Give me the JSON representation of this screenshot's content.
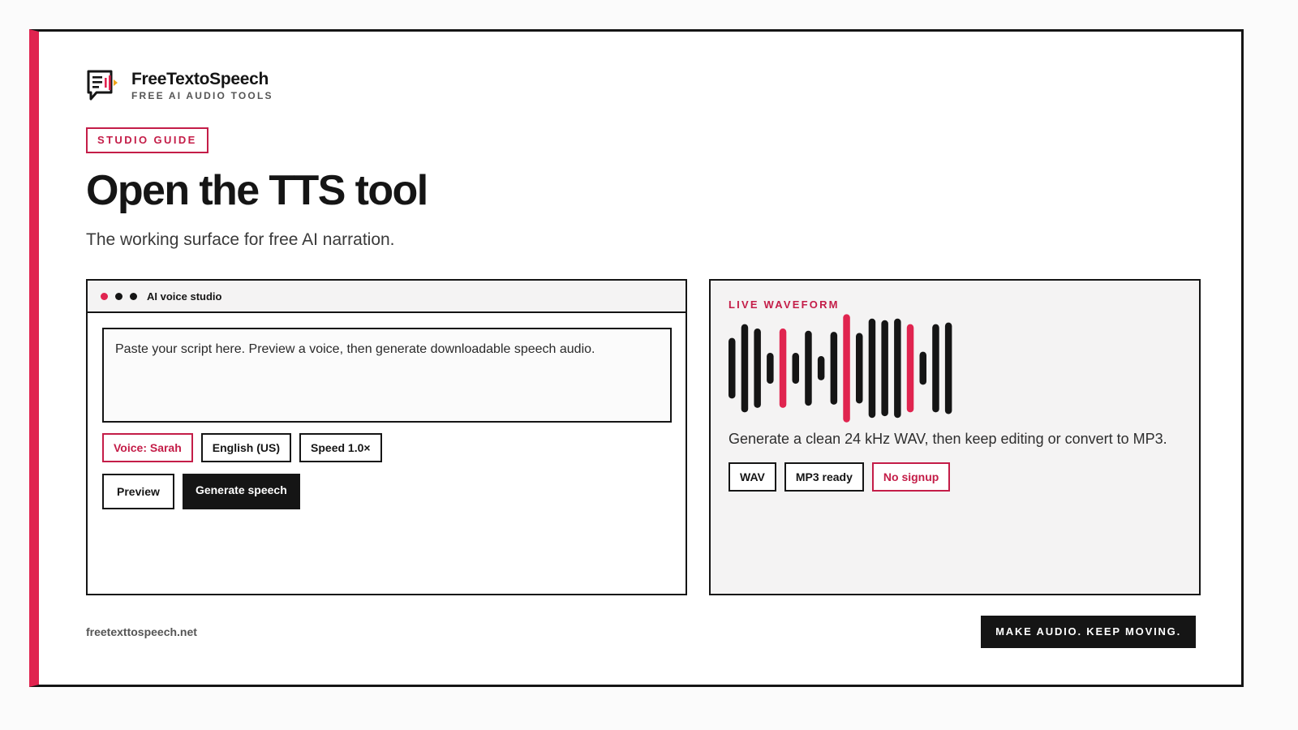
{
  "brand": {
    "name": "FreeTextoSpeech",
    "tagline": "FREE AI AUDIO TOOLS"
  },
  "badge": "STUDIO GUIDE",
  "title": "Open the TTS tool",
  "subtitle": "The working surface for free AI narration.",
  "studio": {
    "label": "AI voice studio",
    "script_text": "Paste your script here. Preview a voice, then generate downloadable speech audio.",
    "chips": [
      "Voice: Sarah",
      "English (US)",
      "Speed 1.0×"
    ],
    "preview_label": "Preview",
    "generate_label": "Generate speech"
  },
  "waveform": {
    "label": "LIVE WAVEFORM",
    "description": "Generate a clean 24 kHz WAV, then keep editing or convert to MP3.",
    "chips": [
      "WAV",
      "MP3 ready",
      "No signup"
    ],
    "bars": [
      {
        "level": 0.55,
        "accent": false
      },
      {
        "level": 0.8,
        "accent": false
      },
      {
        "level": 0.72,
        "accent": false
      },
      {
        "level": 0.28,
        "accent": false
      },
      {
        "level": 0.72,
        "accent": true
      },
      {
        "level": 0.28,
        "accent": false
      },
      {
        "level": 0.68,
        "accent": false
      },
      {
        "level": 0.22,
        "accent": false
      },
      {
        "level": 0.66,
        "accent": false
      },
      {
        "level": 0.98,
        "accent": true
      },
      {
        "level": 0.64,
        "accent": false
      },
      {
        "level": 0.9,
        "accent": false
      },
      {
        "level": 0.87,
        "accent": false
      },
      {
        "level": 0.9,
        "accent": false
      },
      {
        "level": 0.8,
        "accent": true
      },
      {
        "level": 0.3,
        "accent": false
      },
      {
        "level": 0.8,
        "accent": false
      },
      {
        "level": 0.83,
        "accent": false
      }
    ]
  },
  "footer": {
    "url": "freetexttospeech.net",
    "cta": "MAKE AUDIO. KEEP MOVING."
  },
  "colors": {
    "accent": "#e0244f",
    "accent_text": "#c41d48",
    "ink": "#151515"
  }
}
